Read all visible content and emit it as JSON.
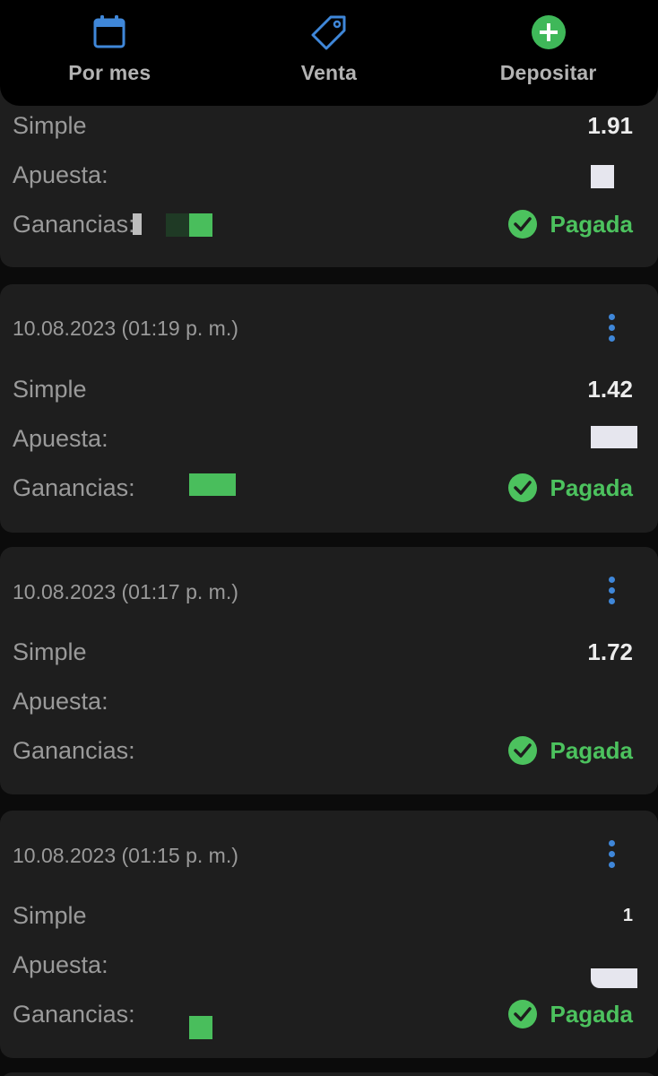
{
  "colors": {
    "background": "#0b0b0b",
    "card": "#1e1e1e",
    "accent_blue": "#3f87d9",
    "accent_green": "#4cc25e",
    "text_muted": "#9a9a9a",
    "text_bright": "#ececec"
  },
  "topbar": {
    "actions": [
      {
        "label": "Por mes",
        "icon": "calendar-icon"
      },
      {
        "label": "Venta",
        "icon": "tag-icon"
      },
      {
        "label": "Depositar",
        "icon": "plus-circle-icon"
      }
    ]
  },
  "labels": {
    "type": "Simple",
    "stake": "Apuesta:",
    "winnings": "Ganancias:"
  },
  "bets": [
    {
      "date": "",
      "odds": "1.91",
      "status": "Pagada"
    },
    {
      "date": "10.08.2023 (01:19 p. m.)",
      "odds": "1.42",
      "status": "Pagada"
    },
    {
      "date": "10.08.2023 (01:17 p. m.)",
      "odds": "1.72",
      "status": "Pagada"
    },
    {
      "date": "10.08.2023 (01:15 p. m.)",
      "odds": "1",
      "status": "Pagada"
    }
  ]
}
